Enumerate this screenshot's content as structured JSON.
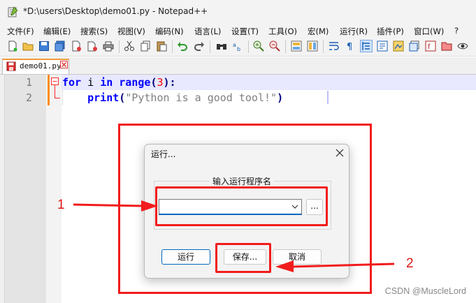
{
  "window": {
    "title": "*D:\\users\\Desktop\\demo01.py - Notepad++"
  },
  "menu": [
    "文件(F)",
    "编辑(E)",
    "搜索(S)",
    "视图(V)",
    "编码(N)",
    "语言(L)",
    "设置(T)",
    "工具(O)",
    "宏(M)",
    "运行(R)",
    "插件(P)",
    "窗口(W)",
    "?"
  ],
  "tab": {
    "label": "demo01.py"
  },
  "editor": {
    "line_numbers": [
      "1",
      "2"
    ],
    "line1": {
      "kw1": "for",
      "var": " i ",
      "kw2": "in",
      "sp": " ",
      "fn": "range",
      "lp": "(",
      "num": "3",
      "rp": ")",
      "colon": ":"
    },
    "line2": {
      "indent": "    ",
      "fn": "print",
      "lp": "(",
      "str": "\"Python is a good tool!\"",
      "rp": ")"
    }
  },
  "dialog": {
    "title": "运行...",
    "group_label": "输入运行程序名",
    "program_value": "",
    "browse_label": "...",
    "run_label": "运行",
    "save_label": "保存...",
    "cancel_label": "取消"
  },
  "annotations": {
    "label1": "1",
    "label2": "2"
  },
  "watermark": "CSDN @MuscleLord",
  "colors": {
    "annotation_red": "#f21c1c",
    "keyword_blue": "#0000ff",
    "accent_orange": "#f39a3c"
  }
}
